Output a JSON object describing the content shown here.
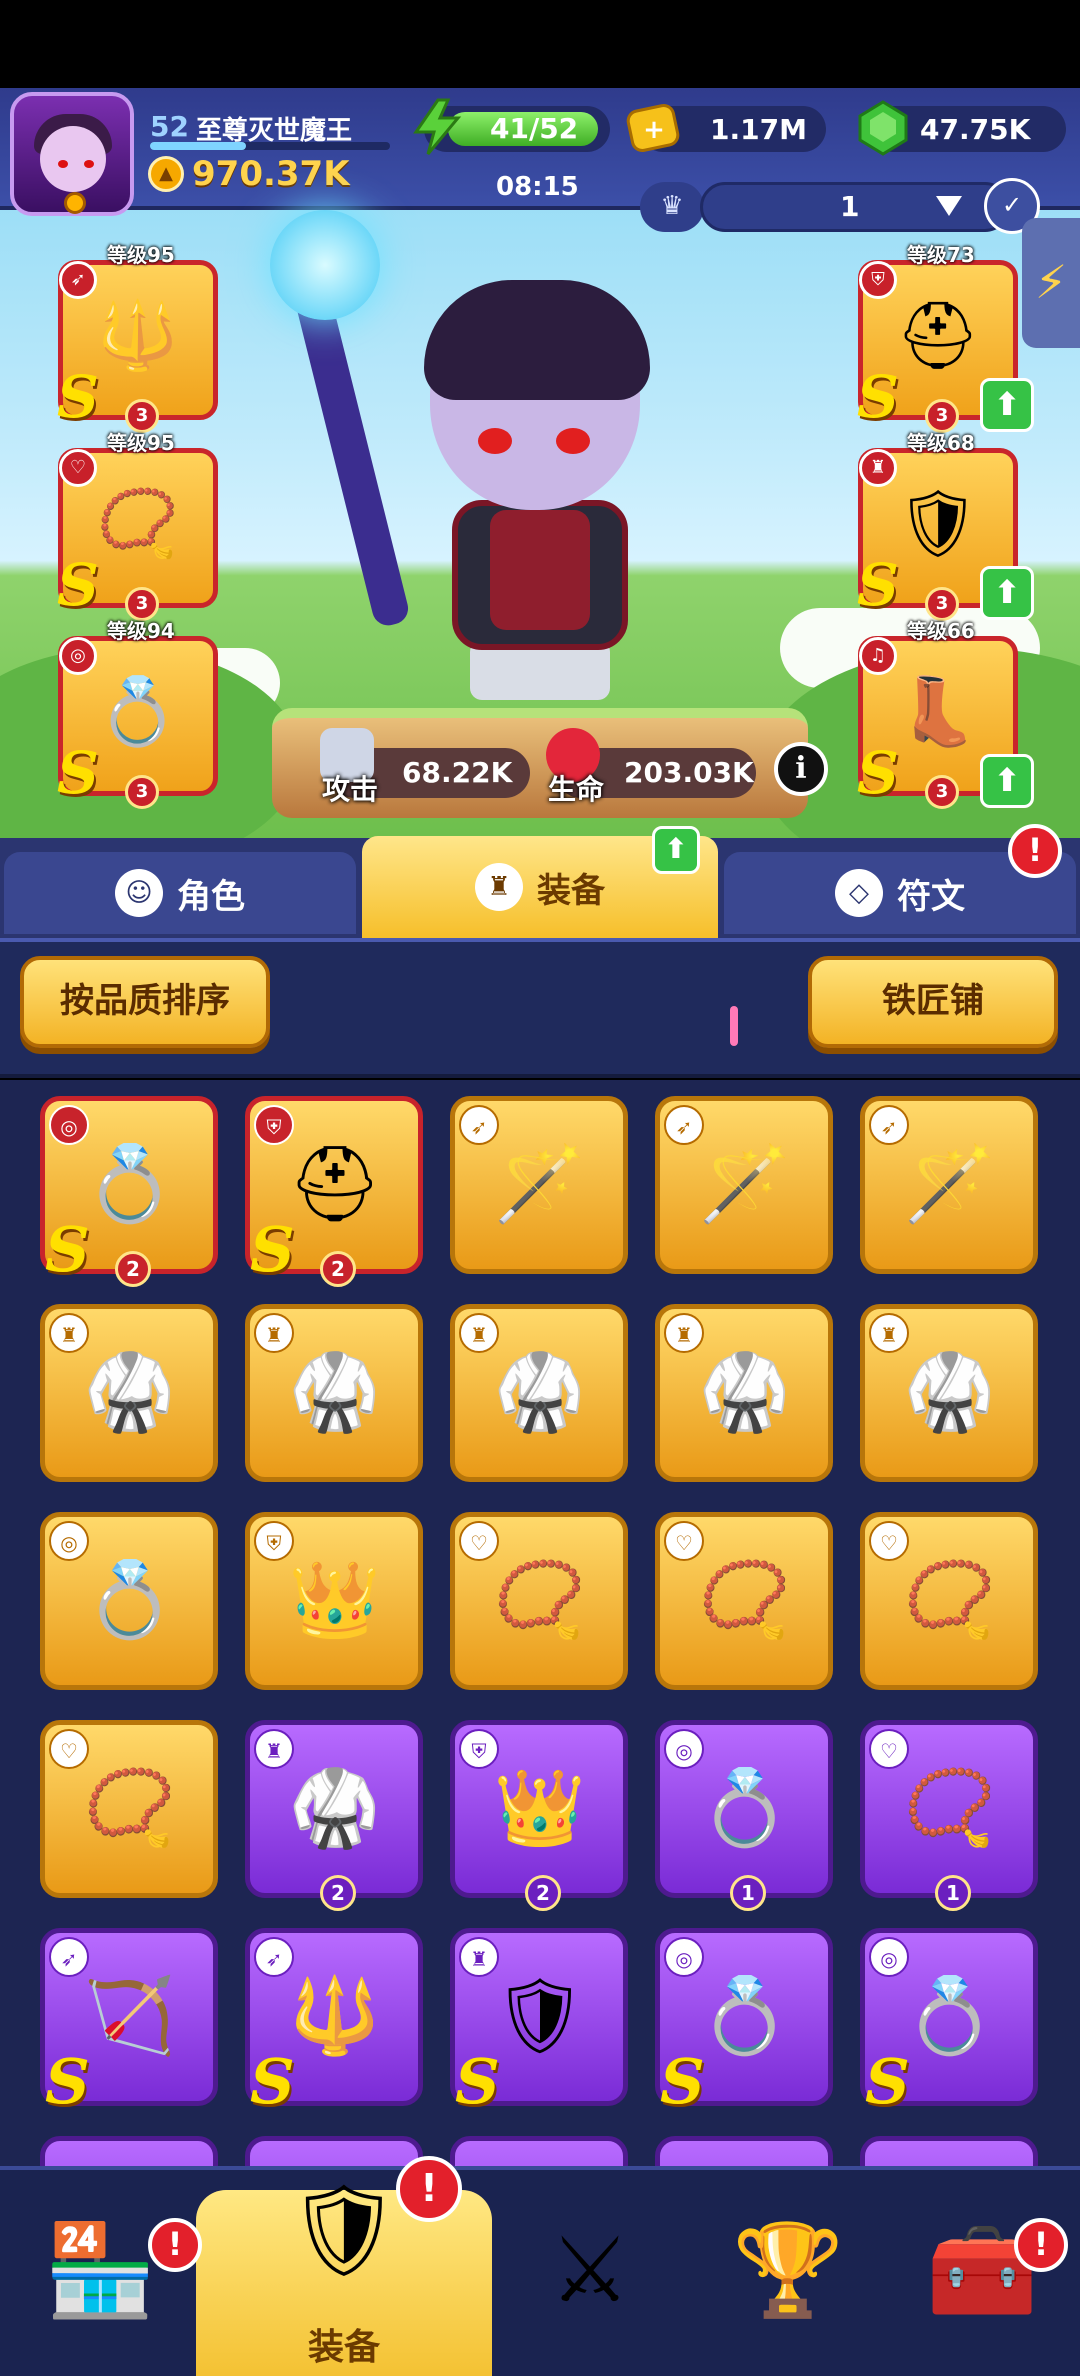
{
  "header": {
    "level": "52",
    "player_name": "至尊灭世魔王",
    "power": "970.37K",
    "energy": "41/52",
    "gold": "1.17M",
    "gems": "47.75K",
    "timer": "08:15",
    "preset_number": "1"
  },
  "equipment_slots": {
    "weapon": {
      "level_label": "等级95",
      "rank": "S",
      "stars": "3"
    },
    "necklace": {
      "level_label": "等级95",
      "rank": "S",
      "stars": "3"
    },
    "ring": {
      "level_label": "等级94",
      "rank": "S",
      "stars": "3"
    },
    "helmet": {
      "level_label": "等级73",
      "rank": "S",
      "stars": "3"
    },
    "armor": {
      "level_label": "等级68",
      "rank": "S",
      "stars": "3"
    },
    "boots": {
      "level_label": "等级66",
      "rank": "S",
      "stars": "3"
    }
  },
  "stats": {
    "attack_label": "攻击",
    "attack_value": "68.22K",
    "hp_label": "生命",
    "hp_value": "203.03K",
    "info_icon": "i"
  },
  "tabs": {
    "role": "角色",
    "equipment": "装备",
    "rune": "符文"
  },
  "toolbar": {
    "sort_button": "按品质排序",
    "smith_button": "铁匠铺"
  },
  "inventory": {
    "rank_label": "S",
    "row1": [
      {
        "count": "2"
      },
      {
        "count": "2"
      }
    ],
    "row4": [
      {
        "count": "2"
      },
      {
        "count": "2"
      },
      {
        "count": "1"
      },
      {
        "count": "1"
      }
    ]
  },
  "bottom_nav": {
    "equipment": "装备"
  },
  "alerts": {
    "mark": "!"
  },
  "colors": {
    "gold": "#f0a21a",
    "purple": "#7a2bd6",
    "red_border": "#c8232b",
    "navy": "#1d2552"
  }
}
